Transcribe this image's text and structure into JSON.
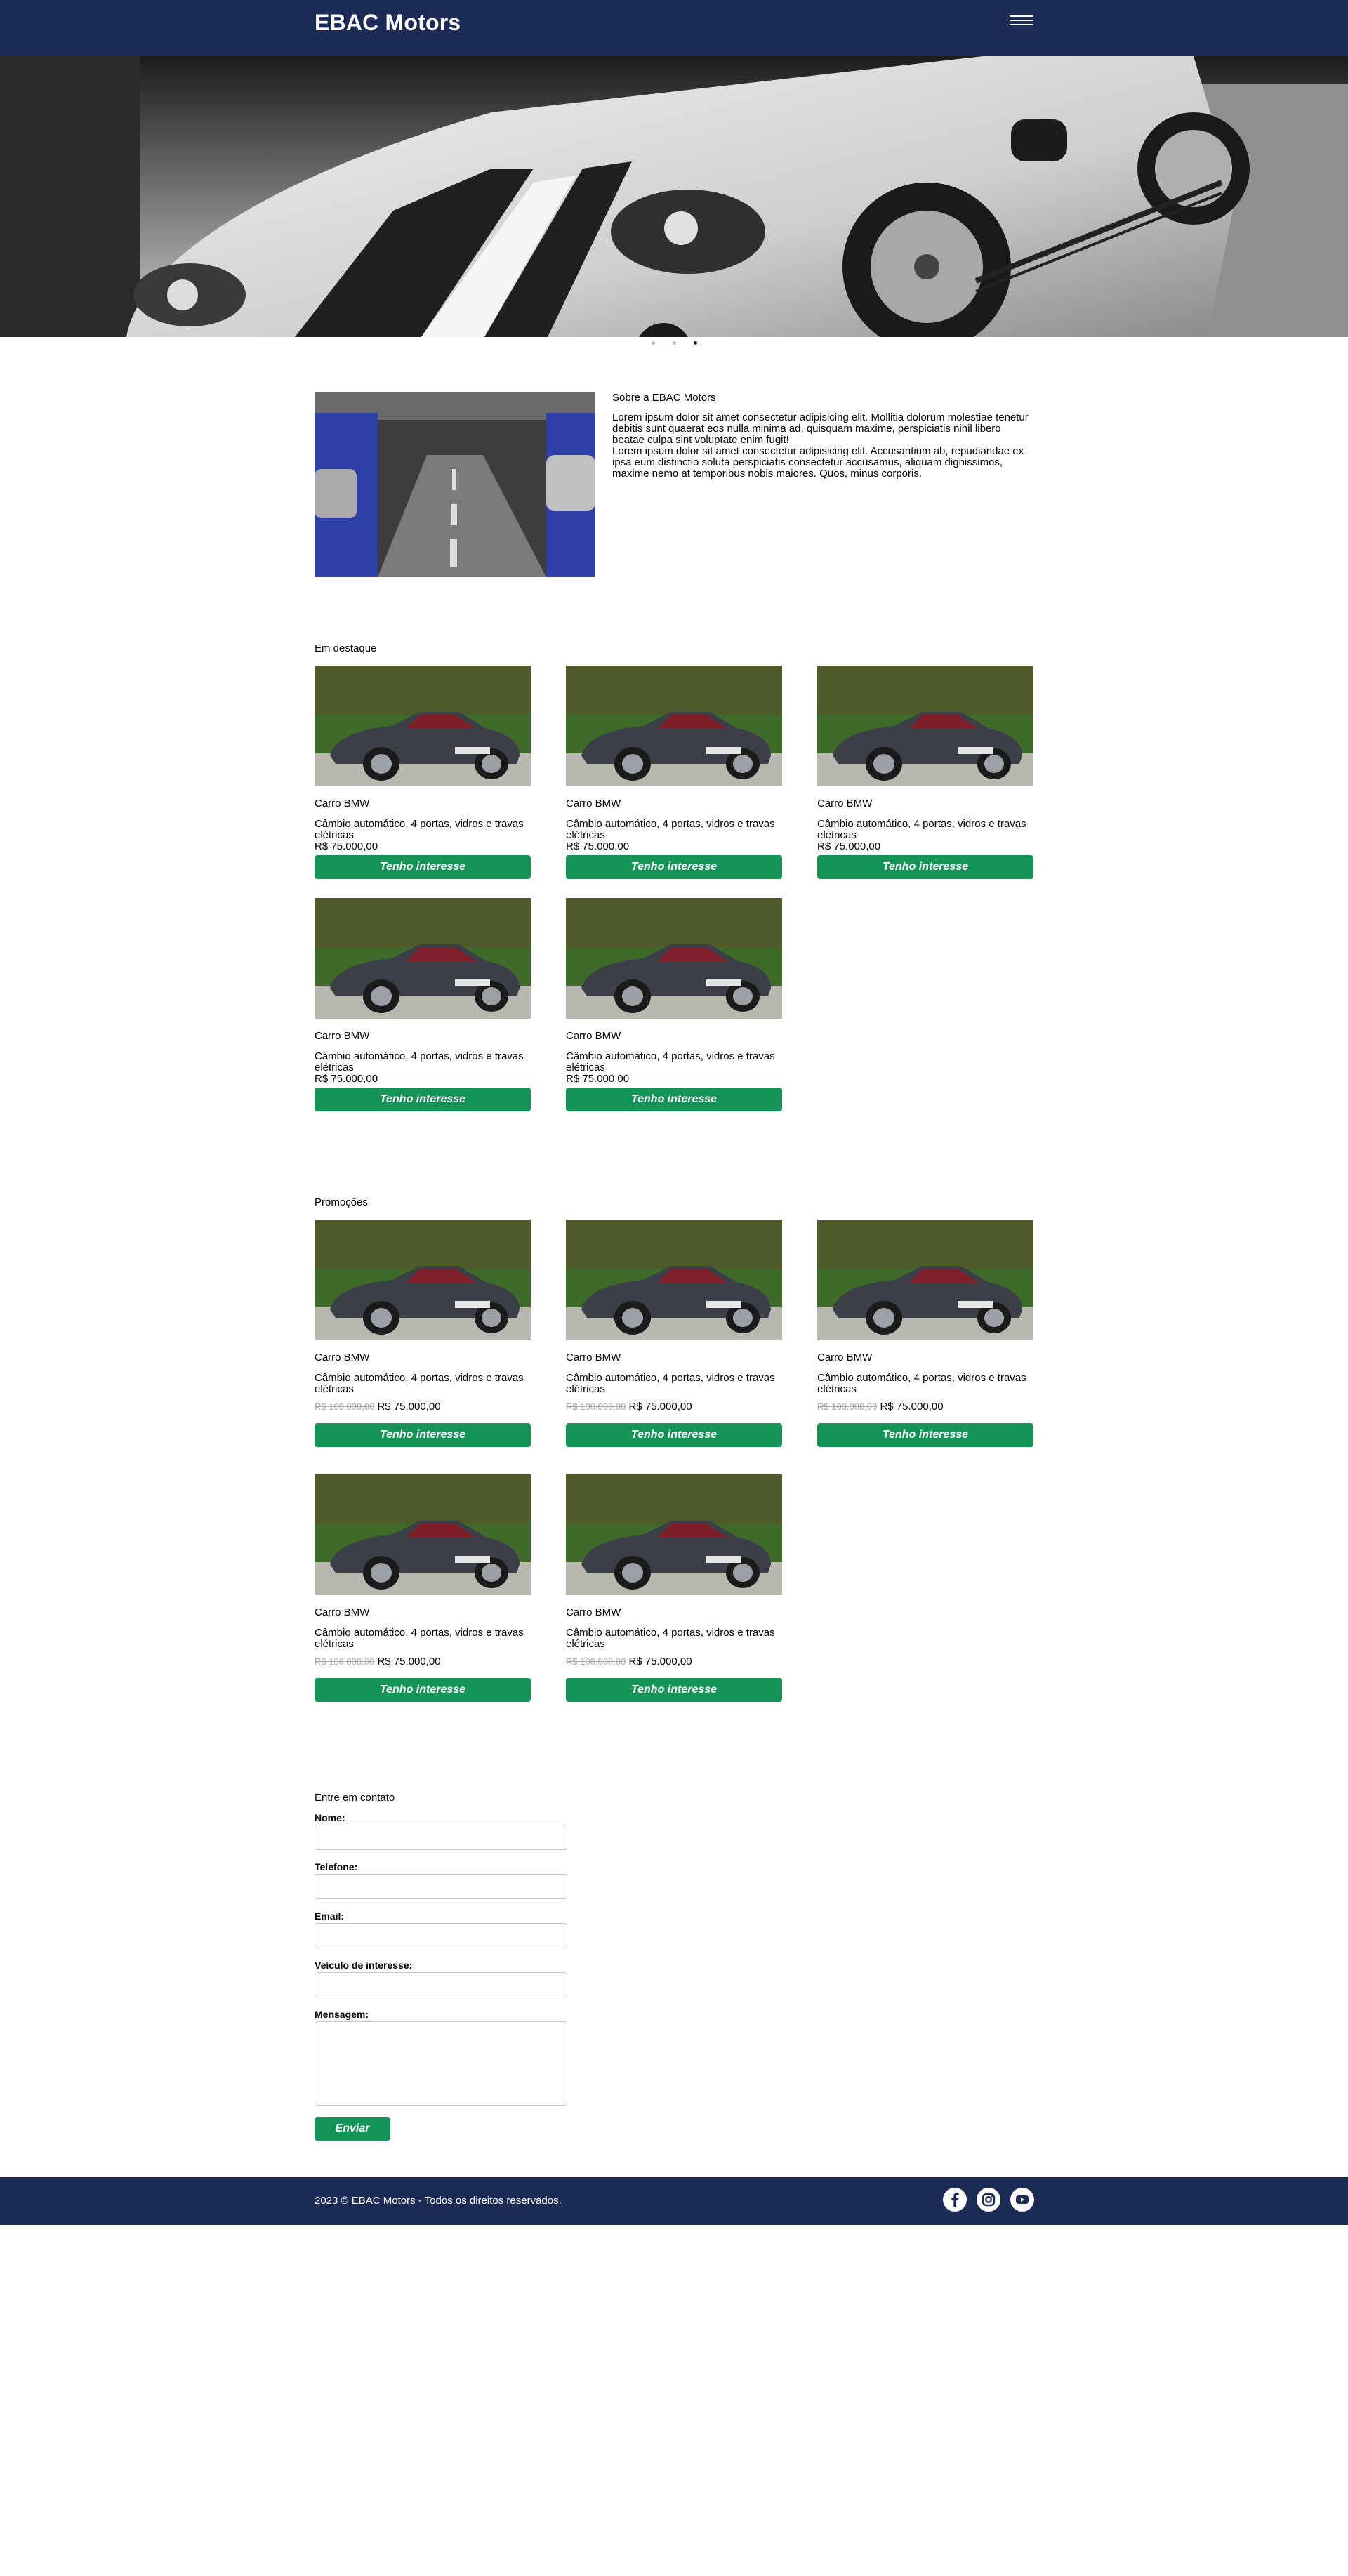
{
  "header": {
    "brand": "EBAC Motors",
    "menu_icon": "hamburger-icon"
  },
  "carousel": {
    "slide_count": 3,
    "active_index": 2
  },
  "about": {
    "title": "Sobre a EBAC Motors",
    "paragraph1": "Lorem ipsum dolor sit amet consectetur adipisicing elit. Mollitia dolorum molestiae tenetur debitis sunt quaerat eos nulla minima ad, quisquam maxime, perspiciatis nihil libero beatae culpa sint voluptate enim fugit!",
    "paragraph2": "Lorem ipsum dolor sit amet consectetur adipisicing elit. Accusantium ab, repudiandae ex ipsa eum distinctio soluta perspiciatis consectetur accusamus, aliquam dignissimos, maxime nemo at temporibus nobis maiores. Quos, minus corporis."
  },
  "featured": {
    "title": "Em destaque",
    "items": [
      {
        "name": "Carro BMW",
        "desc": "Câmbio automático, 4 portas, vidros e travas elétricas",
        "price": "R$ 75.000,00",
        "button": "Tenho interesse"
      },
      {
        "name": "Carro BMW",
        "desc": "Câmbio automático, 4 portas, vidros e travas elétricas",
        "price": "R$ 75.000,00",
        "button": "Tenho interesse"
      },
      {
        "name": "Carro BMW",
        "desc": "Câmbio automático, 4 portas, vidros e travas elétricas",
        "price": "R$ 75.000,00",
        "button": "Tenho interesse"
      },
      {
        "name": "Carro BMW",
        "desc": "Câmbio automático, 4 portas, vidros e travas elétricas",
        "price": "R$ 75.000,00",
        "button": "Tenho interesse"
      },
      {
        "name": "Carro BMW",
        "desc": "Câmbio automático, 4 portas, vidros e travas elétricas",
        "price": "R$ 75.000,00",
        "button": "Tenho interesse"
      }
    ]
  },
  "promotions": {
    "title": "Promoções",
    "items": [
      {
        "name": "Carro BMW",
        "desc": "Câmbio automático, 4 portas, vidros e travas elétricas",
        "old_price": "R$ 100.000,00",
        "price": "R$ 75.000,00",
        "button": "Tenho interesse"
      },
      {
        "name": "Carro BMW",
        "desc": "Câmbio automático, 4 portas, vidros e travas elétricas",
        "old_price": "R$ 100.000,00",
        "price": "R$ 75.000,00",
        "button": "Tenho interesse"
      },
      {
        "name": "Carro BMW",
        "desc": "Câmbio automático, 4 portas, vidros e travas elétricas",
        "old_price": "R$ 100.000,00",
        "price": "R$ 75.000,00",
        "button": "Tenho interesse"
      },
      {
        "name": "Carro BMW",
        "desc": "Câmbio automático, 4 portas, vidros e travas elétricas",
        "old_price": "R$ 100.000,00",
        "price": "R$ 75.000,00",
        "button": "Tenho interesse"
      },
      {
        "name": "Carro BMW",
        "desc": "Câmbio automático, 4 portas, vidros e travas elétricas",
        "old_price": "R$ 100.000,00",
        "price": "R$ 75.000,00",
        "button": "Tenho interesse"
      }
    ]
  },
  "contact": {
    "title": "Entre em contato",
    "name_label": "Nome:",
    "phone_label": "Telefone:",
    "email_label": "Email:",
    "vehicle_label": "Veículo de interesse:",
    "message_label": "Mensagem:",
    "submit": "Enviar"
  },
  "footer": {
    "copyright": "2023 © EBAC Motors - Todos os direitos reservados.",
    "social": [
      "facebook-icon",
      "instagram-icon",
      "youtube-icon"
    ]
  },
  "colors": {
    "navy": "#1b2b56",
    "green": "#149456"
  }
}
